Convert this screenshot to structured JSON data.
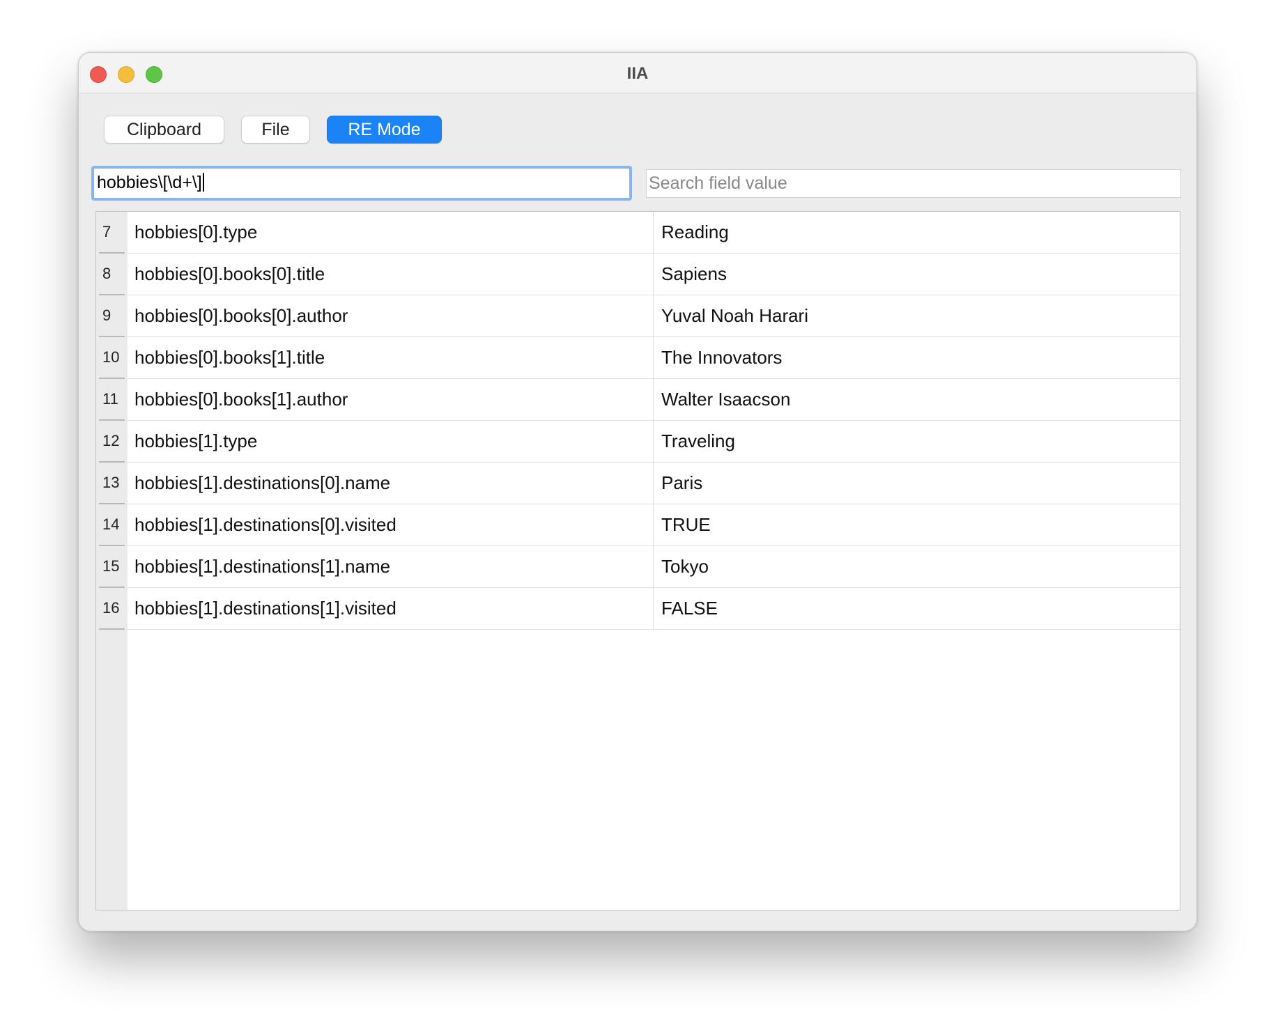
{
  "window": {
    "title": "IIA"
  },
  "toolbar": {
    "clipboard_label": "Clipboard",
    "file_label": "File",
    "re_mode_label": "RE Mode",
    "re_mode_active_color": "#1b83f6"
  },
  "filters": {
    "key_pattern_value": "hobbies\\[\\d+\\]",
    "value_search_placeholder": "Search field value"
  },
  "table": {
    "rows": [
      {
        "num": "7",
        "key": "hobbies[0].type",
        "value": "Reading"
      },
      {
        "num": "8",
        "key": "hobbies[0].books[0].title",
        "value": "Sapiens"
      },
      {
        "num": "9",
        "key": "hobbies[0].books[0].author",
        "value": "Yuval Noah Harari"
      },
      {
        "num": "10",
        "key": "hobbies[0].books[1].title",
        "value": "The Innovators"
      },
      {
        "num": "11",
        "key": "hobbies[0].books[1].author",
        "value": "Walter Isaacson"
      },
      {
        "num": "12",
        "key": "hobbies[1].type",
        "value": "Traveling"
      },
      {
        "num": "13",
        "key": "hobbies[1].destinations[0].name",
        "value": "Paris"
      },
      {
        "num": "14",
        "key": "hobbies[1].destinations[0].visited",
        "value": "TRUE"
      },
      {
        "num": "15",
        "key": "hobbies[1].destinations[1].name",
        "value": "Tokyo"
      },
      {
        "num": "16",
        "key": "hobbies[1].destinations[1].visited",
        "value": "FALSE"
      }
    ]
  }
}
